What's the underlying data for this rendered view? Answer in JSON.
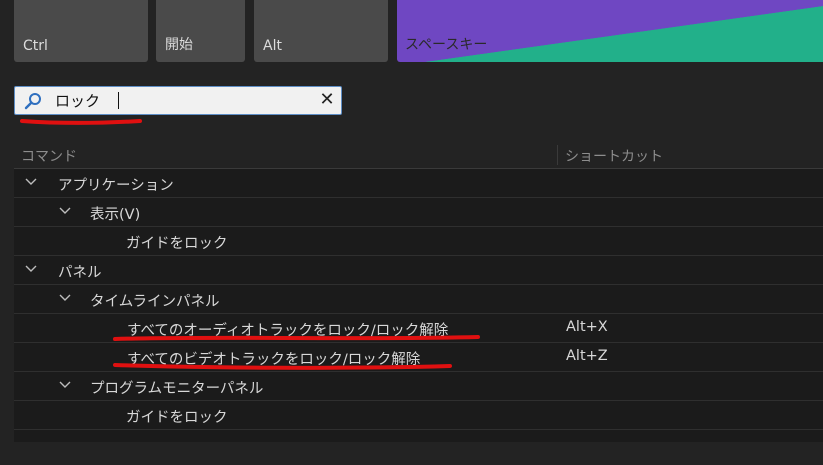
{
  "keyboard": {
    "keys": [
      {
        "label": "Ctrl"
      },
      {
        "label": "開始"
      },
      {
        "label": "Alt"
      },
      {
        "label": "スペースキー"
      }
    ]
  },
  "search": {
    "value": "ロック",
    "clear_icon": "close-icon",
    "search_icon": "search-icon"
  },
  "table": {
    "headers": {
      "command": "コマンド",
      "shortcut": "ショートカット"
    },
    "rows": [
      {
        "label": "アプリケーション",
        "shortcut": ""
      },
      {
        "label": "表示(V)",
        "shortcut": ""
      },
      {
        "label": "ガイドをロック",
        "shortcut": ""
      },
      {
        "label": "パネル",
        "shortcut": ""
      },
      {
        "label": "タイムラインパネル",
        "shortcut": ""
      },
      {
        "label": "すべてのオーディオトラックをロック/ロック解除",
        "shortcut": "Alt+X"
      },
      {
        "label": "すべてのビデオトラックをロック/ロック解除",
        "shortcut": "Alt+Z"
      },
      {
        "label": "プログラムモニターパネル",
        "shortcut": ""
      },
      {
        "label": "ガイドをロック",
        "shortcut": ""
      }
    ]
  },
  "colors": {
    "background": "#232323",
    "key": "#4a4a4a",
    "space_purple": "#6f47c2",
    "space_green": "#22b08a",
    "annotation_red": "#e01010",
    "search_border": "#5e8ec6"
  }
}
